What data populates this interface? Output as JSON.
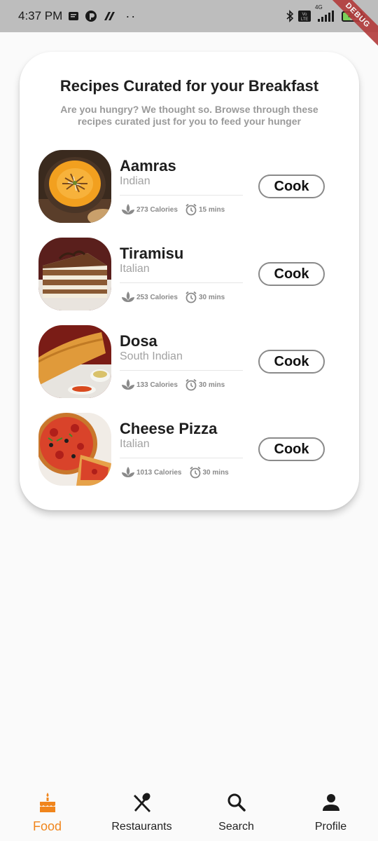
{
  "status_bar": {
    "time": "4:37 PM",
    "dots": "··",
    "network": "4G",
    "volte": "Vo LTE",
    "battery": "40",
    "debug_banner": "DEBUG"
  },
  "header": {
    "title": "Recipes Curated for your Breakfast",
    "subtitle": "Are you hungry? We thought so. Browse through these recipes curated just for you to feed your hunger"
  },
  "recipes": [
    {
      "name": "Aamras",
      "cuisine": "Indian",
      "calories": "273 Calories",
      "time": "15 mins",
      "button": "Cook"
    },
    {
      "name": "Tiramisu",
      "cuisine": "Italian",
      "calories": "253 Calories",
      "time": "30 mins",
      "button": "Cook"
    },
    {
      "name": "Dosa",
      "cuisine": "South Indian",
      "calories": "133 Calories",
      "time": "30 mins",
      "button": "Cook"
    },
    {
      "name": "Cheese Pizza",
      "cuisine": "Italian",
      "calories": "1013 Calories",
      "time": "30 mins",
      "button": "Cook"
    }
  ],
  "bottom_nav": [
    {
      "label": "Food",
      "icon": "cake-icon",
      "active": true
    },
    {
      "label": "Restaurants",
      "icon": "utensils-icon",
      "active": false
    },
    {
      "label": "Search",
      "icon": "search-icon",
      "active": false
    },
    {
      "label": "Profile",
      "icon": "person-icon",
      "active": false
    }
  ],
  "colors": {
    "accent": "#f0851c",
    "status_bar": "#bdbdbd",
    "debug": "#b23b3b"
  }
}
